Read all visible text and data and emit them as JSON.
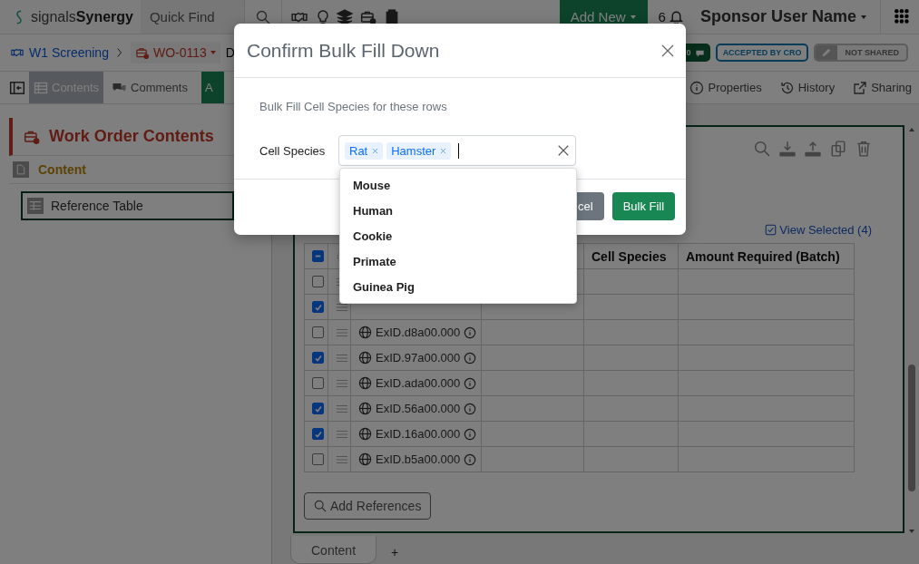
{
  "topbar": {
    "brand_light": "signals",
    "brand_bold": "Synergy",
    "quick_find": {
      "placeholder": "Quick Find"
    },
    "add_new": "Add New",
    "notifications": "6",
    "user": "Sponsor User Name"
  },
  "breadcrumb": {
    "project": "W1 Screening",
    "work_order": "WO-0113",
    "trailing": "D",
    "comments_count": "0",
    "status": "ACCEPTED BY CRO",
    "sharing": "NOT SHARED"
  },
  "toolbar": {
    "tabs": [
      {
        "label": "Contents",
        "selected": true
      },
      {
        "label": "Comments",
        "selected": false
      }
    ],
    "action": "A",
    "links": [
      {
        "kind": "properties",
        "label": "Properties"
      },
      {
        "kind": "history",
        "label": "History"
      },
      {
        "kind": "sharing",
        "label": "Sharing"
      }
    ]
  },
  "sidebar": {
    "title": "Work Order Contents",
    "section": "Content",
    "items": [
      {
        "label": "Reference Table",
        "selected": true
      }
    ]
  },
  "table": {
    "view_selected": "View Selected (4)",
    "select_all_indeterminate": true,
    "columns": [
      "Cell Species",
      "Amount Required (Batch)"
    ],
    "rows": [
      {
        "checked": false
      },
      {
        "checked": true
      },
      {
        "checked": false,
        "id": "ExID.d8a00.000"
      },
      {
        "checked": true,
        "id": "ExID.97a00.000"
      },
      {
        "checked": false,
        "id": "ExID.ada00.000"
      },
      {
        "checked": true,
        "id": "ExID.56a00.000"
      },
      {
        "checked": true,
        "id": "ExID.16a00.000"
      },
      {
        "checked": false,
        "id": "ExID.b5a00.000"
      }
    ],
    "add_references": "Add References"
  },
  "sheet_tabs": [
    {
      "label": "Content",
      "selected": true
    }
  ],
  "add_sheet": "+",
  "modal": {
    "title": "Confirm Bulk Fill Down",
    "description": "Bulk Fill Cell Species for these rows",
    "field_label": "Cell Species",
    "tags": [
      "Rat",
      "Hamster"
    ],
    "options": [
      "Mouse",
      "Human",
      "Cookie",
      "Primate",
      "Guinea Pig"
    ],
    "cancel": "cel",
    "submit": "Bulk Fill"
  }
}
